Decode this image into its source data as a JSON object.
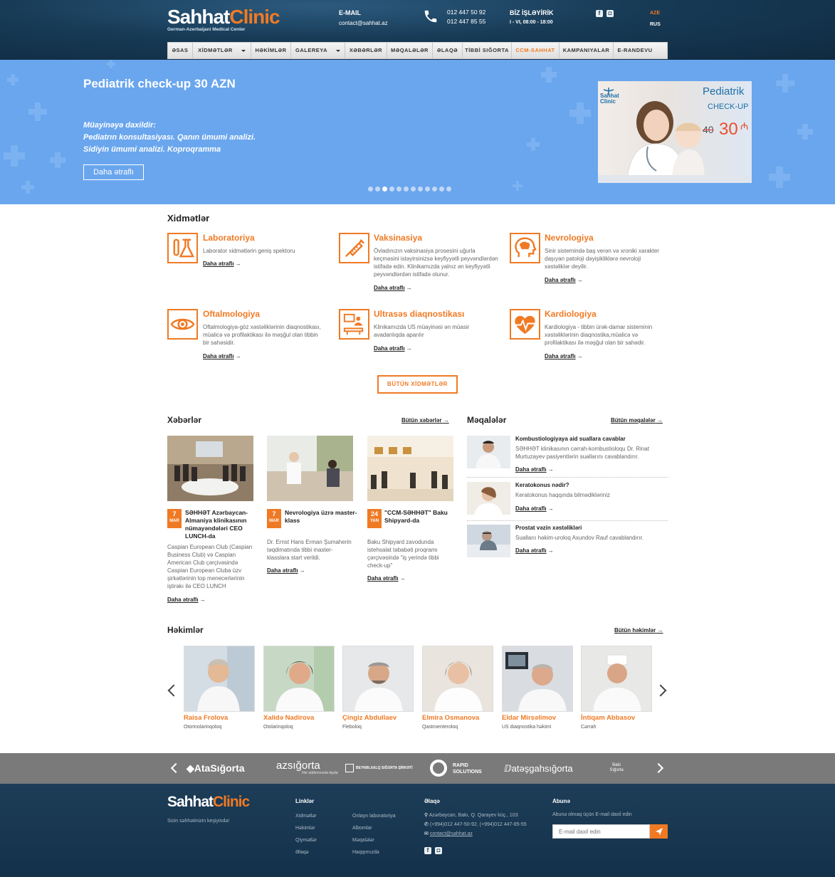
{
  "header": {
    "logo_part1": "Sahhat",
    "logo_part2": "Clinic",
    "logo_sub": "German-Azerbaijani Medical Center",
    "email_label": "E-MAIL",
    "email_value": "contact@sahhat.az",
    "phone1": "012 447 50 92",
    "phone2": "012 447 85 55",
    "hours_label": "BİZ İŞLƏYİRİK",
    "hours_value": "I - VI, 08:00 - 18:00",
    "lang_active": "AZE",
    "lang_other": "RUS"
  },
  "nav": {
    "items": [
      {
        "label": "ƏSAS"
      },
      {
        "label": "XİDMƏTLƏR"
      },
      {
        "label": "HƏKİMLƏR"
      },
      {
        "label": "GALEREYA"
      },
      {
        "label": "XƏBƏRLƏR"
      },
      {
        "label": "MƏQALƏLƏR"
      },
      {
        "label": "ƏLAQƏ"
      },
      {
        "label": "TİBBİ SIĞORTA"
      },
      {
        "label": "CCM-SAHHAT"
      },
      {
        "label": "KAMPANIYALAR"
      },
      {
        "label": "E-RANDEVU"
      }
    ]
  },
  "banner": {
    "title": "Pediatrik check-up 30 AZN",
    "subtitle": "Müayinəyə daxildir:",
    "line1": "Pediatrın konsultasiyası. Qanın ümumi analizi.",
    "line2": "Sidiyin ümumi analizi. Koproqramma",
    "button": "Daha ətraflı",
    "slides_count": 12,
    "active_slide": 3,
    "promo": {
      "logo1": "Sahhat",
      "logo2": "Clinic",
      "title1": "Pediatrik",
      "title2": "CHECK-UP",
      "old_price": "40",
      "new_price": "30"
    }
  },
  "services": {
    "title": "Xidmətlər",
    "more_label": "Daha ətraflı",
    "all_button": "BÜTÜN XİDMƏTLƏR",
    "items": [
      {
        "title": "Laboratoriya",
        "desc": "Laborator xidmətlərin geniş spektoru",
        "icon": "lab-flask-icon"
      },
      {
        "title": "Vaksinasiya",
        "desc": "Övladınızın vaksinasiya prosesini uğurla keçməsini istəyirsinizsə keyfiyyətli peyvəndlərdən istifadə edin. Klinikamızda yalnız ən keyfiyyətli peyvəndlərdən istifadə olunur.",
        "icon": "syringe-icon"
      },
      {
        "title": "Nevrologiya",
        "desc": "Sinir sistemində baş verən və xroniki xarakter daşıyan patoloji dəyişikliklərə nevroloji xəstəliklər deyilir.",
        "icon": "brain-head-icon"
      },
      {
        "title": "Oftalmologiya",
        "desc": "Oftalmologiya-göz xəstəliklərinin diaqnostikası, müalicə və profilaktikası ilə məşğul olan tibbin bir sahəsidir.",
        "icon": "eye-icon"
      },
      {
        "title": "Ultrasəs diaqnostikası",
        "desc": "Klinikamızda US müayinəsi ən müasir avadanlıqda aparılır",
        "icon": "ultrasound-icon"
      },
      {
        "title": "Kardiologiya",
        "desc": "Kardiologiya - tibbin ürək-damar sisteminin xəstəliklərinin diaqnostika,müalicə və profilaktikası ilə məşğul olan bir sahədir.",
        "icon": "heart-pulse-icon"
      }
    ]
  },
  "news": {
    "title": "Xəbərlər",
    "all_link": "Bütün xəbərlər",
    "more_label": "Daha ətraflı",
    "items": [
      {
        "day": "7",
        "month": "MAR",
        "title_lines": [
          "SƏHHƏT Azərbaycan-",
          "Almaniya klinikasının",
          "nümayəndələri CEO",
          "LUNCH-da"
        ],
        "desc_lines": [
          "Caspian European Club (Caspian",
          "Business Club) və Caspian",
          "American Club çərçivəsində",
          "Caspian European Cluba üzv",
          "şirkətlərinin top menecerlərinin",
          "iştirakı ilə CEO LUNCH"
        ]
      },
      {
        "day": "7",
        "month": "MAR",
        "title_lines": [
          "Nevrologiya üzrə master-",
          "klass"
        ],
        "desc_lines": [
          "Dr. Ernst Hans Erman Şumaherin",
          "təqdimatında tibbi master-",
          "klasslara start verildi."
        ]
      },
      {
        "day": "24",
        "month": "YAN",
        "title_lines": [
          "\"CCM-SƏHHƏT\" Baku",
          "Shipyard-da"
        ],
        "desc_lines": [
          "Baku Shipyard zavodunda",
          "istehsalat təbabəti proqramı",
          "çərçivəsində \"iş yerində tibbi",
          "check-up\""
        ]
      }
    ]
  },
  "articles": {
    "title": "Məqalələr",
    "all_link": "Bütün məqalələr",
    "more_label": "Daha ətraflı",
    "items": [
      {
        "title": "Kombustiologiyaya aid suallara cavablar",
        "desc_lines": [
          "SƏHHƏT klinikasının cərrah-kombustioloqu Dr. Rinat",
          "Murtuzayev pasiyentlərin suallarını cavablandırır."
        ]
      },
      {
        "title": "Keratokonus nədir?",
        "desc_lines": [
          "Keratokonus haqqında bilmədikləriniz"
        ]
      },
      {
        "title": "Prostat vəzin xəstəlikləri",
        "desc_lines": [
          "Suallarıı həkim-uroloq Axundov Rauf cavablandırır."
        ]
      }
    ]
  },
  "doctors": {
    "title": "Həkimlər",
    "all_link": "Bütün həkimlər",
    "items": [
      {
        "name": "Raisa Frolova",
        "role": "Otorinolarinqoloq"
      },
      {
        "name": "Xalidə Nadirova",
        "role": "Otolarinqoloq"
      },
      {
        "name": "Çingiz Abdullaev",
        "role": "Fleboloq"
      },
      {
        "name": "Elmira Osmanova",
        "role": "Qastroenteroloq"
      },
      {
        "name": "Eldar Mirsəlimov",
        "role": "US diaqnostika həkimi"
      },
      {
        "name": "İntiqam Abbasov",
        "role": "Cərrah"
      }
    ]
  },
  "partners": {
    "items": [
      "AtaSığorta",
      "azsığorta",
      "BEYNƏLXALQ SIĞORTA ŞİRKƏTİ",
      "RAPID",
      "SOLUTIONS",
      "atəşgahsığorta",
      "Baki Sığorta",
      "Her addımınızda fayda"
    ]
  },
  "footer": {
    "logo_part1": "Sahhat",
    "logo_part2": "Clinic",
    "tagline": "Sizin səhhətinizin keşiyində!",
    "links_title": "Linklər",
    "links_col1": [
      "Xidmətlər",
      "Həkimlər",
      "Qiymətlər",
      "Əlaqə"
    ],
    "links_col2": [
      "Onlayn laboratoriya",
      "Albomlar",
      "Məqalələr",
      "Haqqımızda"
    ],
    "contact_title": "Əlaqə",
    "address": "Azərbaycan, Bakı, Q. Qarayev küç., 103",
    "phones": "(+994)012 447-50-92, (+994)012 447-85-55",
    "email": "contact@sahhat.az",
    "subscribe_title": "Abunə",
    "subscribe_text": "Abunə olmaq üçün E-mail daxil edin",
    "subscribe_placeholder": "E-mail daxil edin"
  },
  "colors": {
    "accent": "#f07a24",
    "header_bg": "#173a55",
    "banner_bg": "#6aa6ee",
    "footer_bg": "#1a3a55",
    "partners_bg": "#7a7a7a"
  }
}
